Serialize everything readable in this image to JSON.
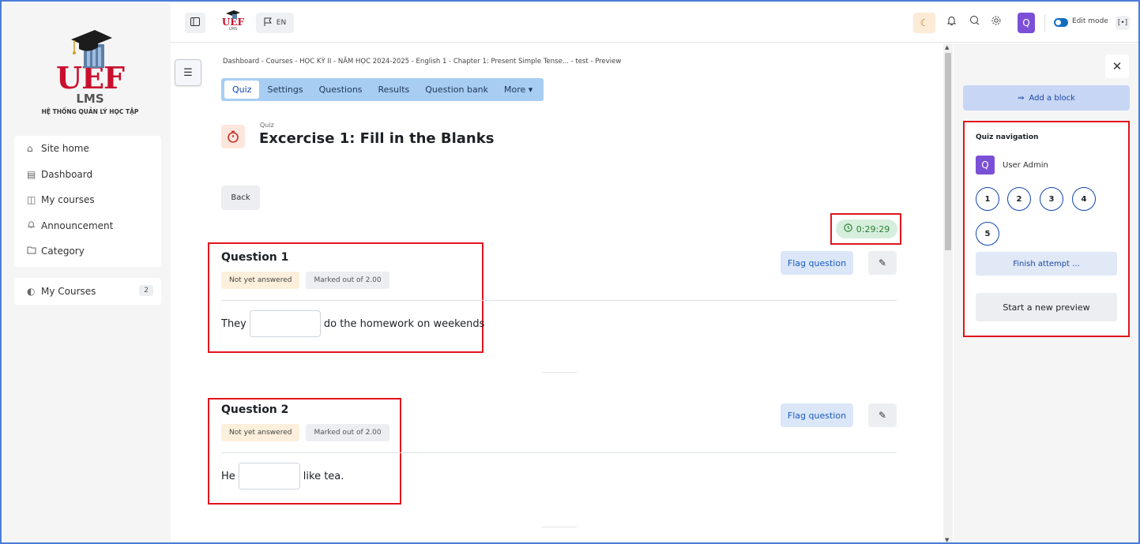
{
  "brand": {
    "logo_text": "UEF",
    "lms": "LMS",
    "subtitle": "HỆ THỐNG QUẢN LÝ HỌC TẬP",
    "small_logo_text": "UEF",
    "small_logo_sub": "LMS"
  },
  "sidebar": {
    "items": [
      {
        "label": "Site home",
        "icon": "home-icon"
      },
      {
        "label": "Dashboard",
        "icon": "dashboard-icon"
      },
      {
        "label": "My courses",
        "icon": "book-icon"
      },
      {
        "label": "Announcement",
        "icon": "bell-icon"
      },
      {
        "label": "Category",
        "icon": "folder-icon"
      }
    ],
    "my_courses": {
      "label": "My Courses",
      "count": "2"
    }
  },
  "topbar": {
    "language": "EN",
    "avatar_letter": "Q",
    "edit_mode_label": "Edit mode"
  },
  "breadcrumb": "Dashboard  -  Courses  -  HỌC KỲ II - NĂM HỌC 2024-2025  -  English 1  -  Chapter 1: Present Simple Tense...  -  test  -  Preview",
  "tabs": [
    {
      "label": "Quiz",
      "active": true
    },
    {
      "label": "Settings",
      "active": false
    },
    {
      "label": "Questions",
      "active": false
    },
    {
      "label": "Results",
      "active": false
    },
    {
      "label": "Question bank",
      "active": false
    },
    {
      "label": "More ▾",
      "active": false
    }
  ],
  "page": {
    "kicker": "Quiz",
    "title": "Excercise 1: Fill in the Blanks",
    "back_label": "Back",
    "timer": "0:29:29"
  },
  "questions": [
    {
      "title": "Question 1",
      "status": "Not yet answered",
      "marks": "Marked out of 2.00",
      "text_before": "They",
      "text_after": "do the homework on weekends",
      "answer": "",
      "flag_label": "Flag question"
    },
    {
      "title": "Question 2",
      "status": "Not yet answered",
      "marks": "Marked out of 2.00",
      "text_before": "He",
      "text_after": "like tea.",
      "answer": "",
      "flag_label": "Flag question"
    }
  ],
  "drawer": {
    "add_block_label": "Add a block",
    "quiz_nav_title": "Quiz navigation",
    "user_letter": "Q",
    "user_name": "User Admin",
    "question_numbers": [
      "1",
      "2",
      "3",
      "4",
      "5"
    ],
    "finish_label": "Finish attempt ...",
    "new_preview_label": "Start a new preview"
  },
  "colors": {
    "highlight_border": "#e0151d",
    "brand_red": "#c8102e",
    "primary_blue": "#0f47ad",
    "avatar_purple": "#7b4fd6",
    "tabs_bg": "#a8cdf3"
  }
}
